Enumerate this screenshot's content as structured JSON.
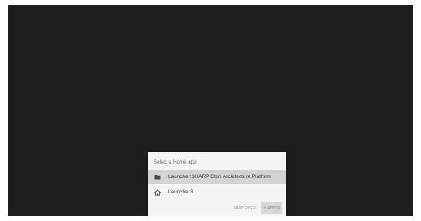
{
  "dialog": {
    "title": "Select a Home app",
    "options": [
      {
        "label": "Launcher:SHARP Opin Architecture Platform",
        "icon": "folder-icon",
        "selected": true
      },
      {
        "label": "Launcher3",
        "icon": "home-icon",
        "selected": false
      }
    ],
    "buttons": {
      "just_once": "JUST ONCE",
      "always": "ALWAYS"
    }
  },
  "colors": {
    "screen_background": "#1e1e1e",
    "dialog_background": "#f4f4f4",
    "selected_row": "#d3d3d3"
  }
}
